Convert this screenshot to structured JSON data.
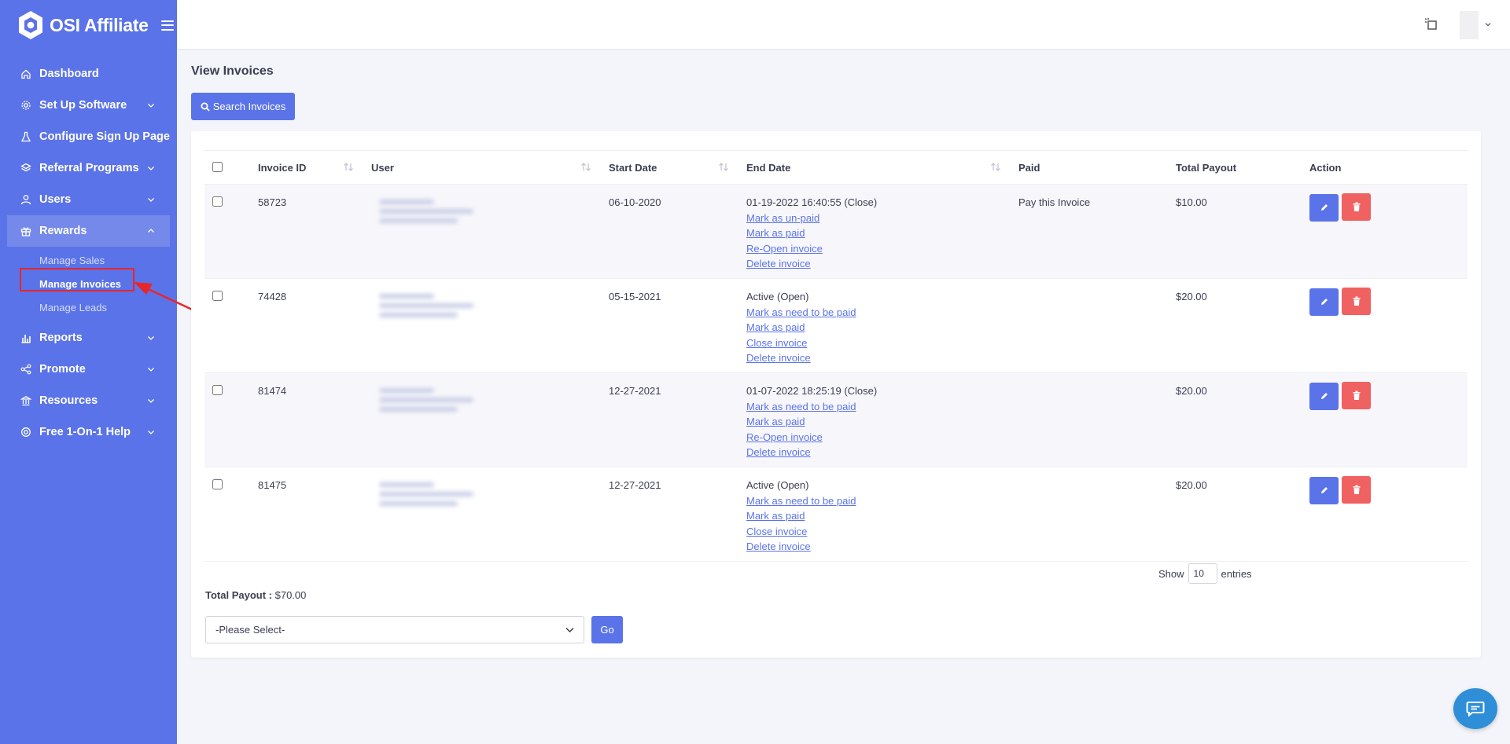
{
  "brand": {
    "name": "OSI Affiliate"
  },
  "sidebar": {
    "items": [
      {
        "label": "Dashboard",
        "icon": "home-icon",
        "has_chevron": false
      },
      {
        "label": "Set Up Software",
        "icon": "gear-icon",
        "has_chevron": true
      },
      {
        "label": "Configure Sign Up Page",
        "icon": "flask-icon",
        "has_chevron": false
      },
      {
        "label": "Referral Programs",
        "icon": "layers-icon",
        "has_chevron": true
      },
      {
        "label": "Users",
        "icon": "user-icon",
        "has_chevron": true
      },
      {
        "label": "Rewards",
        "icon": "gift-icon",
        "has_chevron": true,
        "expanded": true,
        "sub_items": [
          {
            "label": "Manage Sales"
          },
          {
            "label": "Manage Invoices",
            "current": true
          },
          {
            "label": "Manage Leads"
          }
        ]
      },
      {
        "label": "Reports",
        "icon": "bar-chart-icon",
        "has_chevron": true
      },
      {
        "label": "Promote",
        "icon": "share-icon",
        "has_chevron": true
      },
      {
        "label": "Resources",
        "icon": "bank-icon",
        "has_chevron": true
      },
      {
        "label": "Free 1-On-1 Help",
        "icon": "lifebuoy-icon",
        "has_chevron": true
      }
    ]
  },
  "page": {
    "title": "View Invoices",
    "search_button": "Search Invoices"
  },
  "table": {
    "columns": [
      "Invoice ID",
      "User",
      "Start Date",
      "End Date",
      "Paid",
      "Total Payout",
      "Action"
    ],
    "rows": [
      {
        "invoice_id": "58723",
        "start_date": "06-10-2020",
        "end_status": "01-19-2022 16:40:55 (Close)",
        "links": [
          "Mark as un-paid",
          "Mark as paid",
          "Re-Open invoice",
          "Delete invoice"
        ],
        "paid": "Pay this Invoice",
        "total_payout": "$10.00"
      },
      {
        "invoice_id": "74428",
        "start_date": "05-15-2021",
        "end_status": "Active (Open)",
        "links": [
          "Mark as need to be paid",
          "Mark as paid",
          "Close invoice",
          "Delete invoice"
        ],
        "paid": "",
        "total_payout": "$20.00"
      },
      {
        "invoice_id": "81474",
        "start_date": "12-27-2021",
        "end_status": "01-07-2022 18:25:19 (Close)",
        "links": [
          "Mark as need to be paid",
          "Mark as paid",
          "Re-Open invoice",
          "Delete invoice"
        ],
        "paid": "",
        "total_payout": "$20.00"
      },
      {
        "invoice_id": "81475",
        "start_date": "12-27-2021",
        "end_status": "Active (Open)",
        "links": [
          "Mark as need to be paid",
          "Mark as paid",
          "Close invoice",
          "Delete invoice"
        ],
        "paid": "",
        "total_payout": "$20.00"
      }
    ]
  },
  "footer": {
    "show_label": "Show",
    "entries_value": "10",
    "entries_label": "entries",
    "total_label": "Total Payout :",
    "total_value": "$70.00",
    "select_placeholder": "-Please Select-",
    "go_label": "Go"
  },
  "colors": {
    "primary": "#5b73e8",
    "danger": "#f06161",
    "annotation": "#e8262a",
    "chat": "#2e8fd8"
  }
}
